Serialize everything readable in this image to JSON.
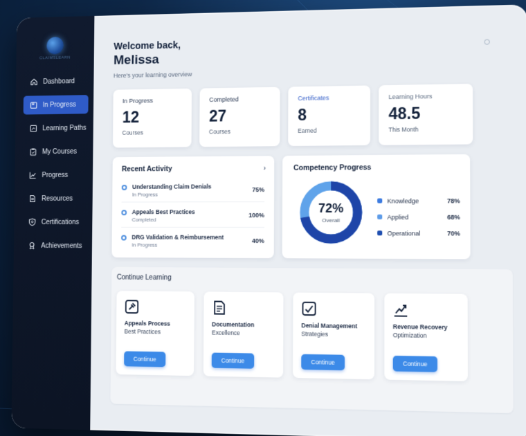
{
  "app": {
    "logo_text": "CLAIMSLEARN"
  },
  "sidebar": {
    "items": [
      {
        "label": "Dashboard",
        "icon": "home-icon",
        "active": false
      },
      {
        "label": "In Progress",
        "icon": "book-icon",
        "active": true
      },
      {
        "label": "Learning Paths",
        "icon": "path-icon",
        "active": false
      },
      {
        "label": "My Courses",
        "icon": "clipboard-icon",
        "active": false
      },
      {
        "label": "Progress",
        "icon": "chart-icon",
        "active": false
      },
      {
        "label": "Resources",
        "icon": "document-icon",
        "active": false
      },
      {
        "label": "Certifications",
        "icon": "shield-icon",
        "active": false
      },
      {
        "label": "Achievements",
        "icon": "trophy-icon",
        "active": false
      }
    ]
  },
  "header": {
    "welcome": "Welcome back,",
    "name": "Melissa",
    "subtitle": "Here's your learning overview"
  },
  "stats": [
    {
      "label": "In Progress",
      "value": "12",
      "sub": "Courses"
    },
    {
      "label": "Completed",
      "value": "27",
      "sub": "Courses"
    },
    {
      "label": "Certificates",
      "value": "8",
      "sub": "Earned"
    },
    {
      "label": "Learning Hours",
      "value": "48.5",
      "sub": "This Month"
    }
  ],
  "recent_activity": {
    "title": "Recent Activity",
    "items": [
      {
        "title": "Understanding Claim Denials",
        "status": "In Progress",
        "pct": "75%"
      },
      {
        "title": "Appeals Best Practices",
        "status": "Completed",
        "pct": "100%"
      },
      {
        "title": "DRG Validation & Reimbursement",
        "status": "In Progress",
        "pct": "40%"
      }
    ]
  },
  "competency": {
    "title": "Competency Progress",
    "overall_pct": "72%",
    "overall_label": "Overall",
    "overall_value": 72,
    "items": [
      {
        "name": "Knowledge",
        "value": "78%",
        "color": "#3c7be0"
      },
      {
        "name": "Applied",
        "value": "68%",
        "color": "#5d9be8"
      },
      {
        "name": "Operational",
        "value": "70%",
        "color": "#1f4fb0"
      }
    ],
    "colors": {
      "track": "#5fa3ea",
      "fill": "#1e45a8"
    }
  },
  "continue_learning": {
    "title": "Continue Learning",
    "button_label": "Continue",
    "courses": [
      {
        "title": "Appeals Process",
        "sub": "Best Practices",
        "icon": "gavel-icon"
      },
      {
        "title": "Documentation",
        "sub": "Excellence",
        "icon": "document-icon"
      },
      {
        "title": "Denial Management",
        "sub": "Strategies",
        "icon": "check-chart-icon"
      },
      {
        "title": "Revenue Recovery",
        "sub": "Optimization",
        "icon": "trend-up-icon"
      }
    ]
  }
}
